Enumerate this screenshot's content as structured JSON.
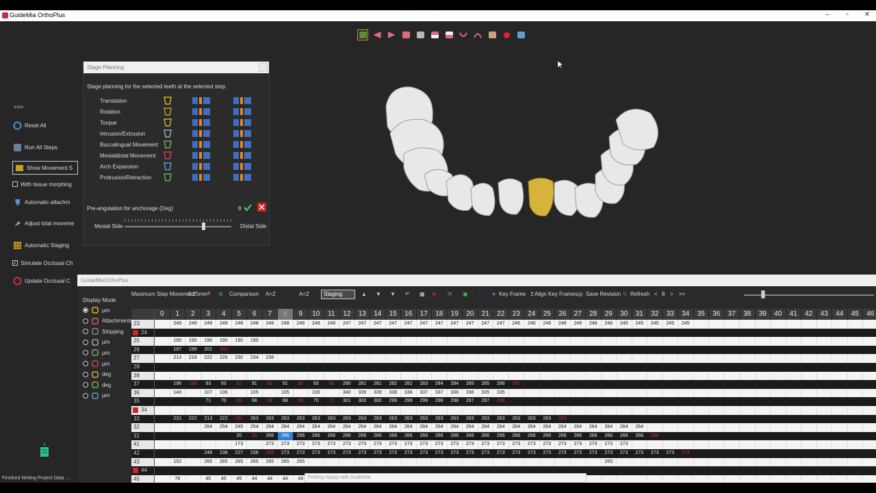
{
  "window": {
    "title": "GuideMia OrthoPlus"
  },
  "left_tools": {
    "expand": ">>>",
    "items": [
      {
        "label": "Reset All"
      },
      {
        "label": "Run All Steps"
      },
      {
        "label": "Show Movement S"
      },
      {
        "label": "With tissue morphing"
      },
      {
        "label": "Automatic attachm"
      },
      {
        "label": "Adjust total moveme"
      },
      {
        "label": "Automatic Staging"
      },
      {
        "label": "Simulate Occlusal Ch"
      },
      {
        "label": "Update Occlusal C"
      }
    ]
  },
  "stage_panel": {
    "title": "Stage Planning",
    "description": "Stage planning for the selected teeth at the selected step.",
    "movements": [
      {
        "label": "Translation",
        "icon": "translation-arrow-icon",
        "color": "#e0b020"
      },
      {
        "label": "Rotation",
        "icon": "rotation-icon",
        "color": "#c0a020"
      },
      {
        "label": "Torque",
        "icon": "torque-tooth-icon",
        "color": "#c8b040"
      },
      {
        "label": "Intrusion/Extrusion",
        "icon": "intrusion-tooth-icon",
        "color": "#a0a8b8"
      },
      {
        "label": "Buccalingual Movement",
        "icon": "buccalingual-tooth-icon",
        "color": "#7ab050"
      },
      {
        "label": "Mesialdistal Movement",
        "icon": "mesialdistal-tooth-icon",
        "color": "#d04060"
      },
      {
        "label": "Arch Expansion",
        "icon": "arch-expansion-icon",
        "color": "#50a0d0"
      },
      {
        "label": "Protrusion/Retraction",
        "icon": "protrusion-icon",
        "color": "#60b060"
      }
    ],
    "pre_angulation_label": "Pre-angulation for anchorage (Deg)",
    "pre_angulation_value": "8",
    "mesial_label": "Mesial Side",
    "distal_label": "Distal Side"
  },
  "bottom_panel": {
    "title": "GuideMiaOrthoPlus",
    "display_mode_label": "Display Mode",
    "display_modes": [
      {
        "label": "µm",
        "selected": true
      },
      {
        "label": "Attachments",
        "selected": false
      },
      {
        "label": "Stripping",
        "selected": false
      },
      {
        "label": "µm",
        "selected": false
      },
      {
        "label": "µm",
        "selected": false
      },
      {
        "label": "µm",
        "selected": false
      },
      {
        "label": "deg",
        "selected": false
      },
      {
        "label": "deg",
        "selected": false
      },
      {
        "label": "µm",
        "selected": false
      }
    ],
    "toolbar": {
      "max_step_label": "Maximum Step Movement",
      "max_step_value": "0.25mm",
      "comparison": "Comparison",
      "a_to_z": "A>Z",
      "z_to_a": "A<Z",
      "staging": "Staging",
      "key_frame": "Key Frame",
      "align_key_frames": "Align Key Frames",
      "save_revision": "Save Revision",
      "refresh": "Refresh",
      "step_prev": "<",
      "step_value": "8",
      "step_next": ">",
      "step_last": ">>"
    },
    "columns": [
      "0",
      "1",
      "2",
      "3",
      "4",
      "5",
      "6",
      "7",
      "8",
      "9",
      "10",
      "11",
      "12",
      "13",
      "14",
      "15",
      "16",
      "17",
      "18",
      "19",
      "20",
      "21",
      "22",
      "23",
      "24",
      "25",
      "26",
      "27",
      "28",
      "29",
      "30",
      "31",
      "32",
      "33",
      "34",
      "35",
      "36",
      "37",
      "38",
      "39",
      "40",
      "41",
      "42",
      "43",
      "44",
      "45",
      "46"
    ],
    "rows": [
      {
        "tooth": "23",
        "cells": [
          "",
          "249",
          "249",
          "249",
          "249",
          "248",
          "248",
          "248",
          "248",
          "248",
          "248",
          "248",
          "247",
          "247",
          "247",
          "247",
          "247",
          "247",
          "247",
          "247",
          "247",
          "247",
          "247",
          "246",
          "246",
          "246",
          "246",
          "246",
          "246",
          "246",
          "245",
          "245",
          "245",
          "245",
          "245",
          "",
          "",
          "",
          "",
          "",
          "",
          "",
          "",
          "",
          "",
          ""
        ],
        "red": []
      },
      {
        "tooth": "24",
        "missing": true,
        "cells": [],
        "red": []
      },
      {
        "tooth": "25",
        "cells": [
          "",
          "190",
          "190",
          "190",
          "190",
          "190",
          "190",
          "",
          "",
          "",
          "",
          "",
          "",
          "",
          "",
          "",
          "",
          "",
          "",
          "",
          "",
          "",
          "",
          ""
        ],
        "red": []
      },
      {
        "tooth": "26",
        "cells": [
          "",
          "197",
          "199",
          "201",
          "202"
        ],
        "red": [
          4
        ]
      },
      {
        "tooth": "27",
        "cells": [
          "",
          "213",
          "218",
          "222",
          "226",
          "230",
          "234",
          "238"
        ],
        "red": []
      },
      {
        "tooth": "28",
        "cells": [],
        "red": []
      },
      {
        "tooth": "38",
        "cells": [],
        "red": []
      },
      {
        "tooth": "37",
        "cells": [
          "",
          "196",
          "196",
          "93",
          "93",
          "92",
          "91",
          "91",
          "91",
          "92",
          "93",
          "93",
          "280",
          "281",
          "281",
          "282",
          "282",
          "283",
          "284",
          "284",
          "285",
          "285",
          "286",
          "287"
        ],
        "red": [
          2,
          5,
          7,
          9,
          11,
          23
        ]
      },
      {
        "tooth": "36",
        "cells": [
          "",
          "140",
          "",
          "107",
          "106",
          "",
          "105",
          "",
          "105",
          "",
          "106",
          "",
          "340",
          "339",
          "339",
          "338",
          "338",
          "337",
          "337",
          "336",
          "336",
          "335",
          "335"
        ],
        "red": []
      },
      {
        "tooth": "35",
        "cells": [
          "",
          "",
          "",
          "71",
          "70",
          "69",
          "68",
          "68",
          "68",
          "69",
          "70",
          "71",
          "301",
          "300",
          "300",
          "299",
          "299",
          "299",
          "298",
          "298",
          "297",
          "297",
          "296"
        ],
        "red": [
          5,
          7,
          9,
          11,
          22
        ]
      },
      {
        "tooth": "34",
        "missing": true,
        "cells": [],
        "red": []
      },
      {
        "tooth": "33",
        "cells": [
          "",
          "231",
          "222",
          "213",
          "222",
          "231",
          "263",
          "263",
          "263",
          "263",
          "263",
          "263",
          "263",
          "263",
          "263",
          "263",
          "263",
          "263",
          "263",
          "263",
          "263",
          "263",
          "263",
          "263",
          "263",
          "263",
          "263"
        ],
        "red": [
          5,
          26
        ]
      },
      {
        "tooth": "32",
        "cells": [
          "",
          "",
          "",
          "264",
          "254",
          "245",
          "254",
          "264",
          "264",
          "264",
          "264",
          "264",
          "264",
          "264",
          "264",
          "264",
          "264",
          "264",
          "264",
          "264",
          "264",
          "264",
          "264",
          "264",
          "264",
          "264",
          "264",
          "264",
          "264",
          "264",
          "264",
          "264"
        ],
        "red": []
      },
      {
        "tooth": "31",
        "cells": [
          "",
          "",
          "",
          "",
          "",
          "20",
          "20",
          "266",
          "266",
          "266",
          "266",
          "266",
          "266",
          "266",
          "266",
          "266",
          "266",
          "266",
          "266",
          "266",
          "266",
          "266",
          "266",
          "266",
          "266",
          "266",
          "266",
          "266",
          "266",
          "266",
          "266",
          "266",
          "266"
        ],
        "red": [
          6,
          32
        ]
      },
      {
        "tooth": "41",
        "cells": [
          "",
          "",
          "",
          "",
          "",
          "173",
          "",
          "273",
          "273",
          "273",
          "273",
          "273",
          "273",
          "273",
          "273",
          "273",
          "273",
          "273",
          "273",
          "273",
          "273",
          "273",
          "273",
          "273",
          "273",
          "273",
          "273",
          "273",
          "273",
          "273",
          "273"
        ],
        "red": []
      },
      {
        "tooth": "42",
        "cells": [
          "",
          "",
          "",
          "248",
          "238",
          "227",
          "238",
          "249",
          "273",
          "273",
          "273",
          "273",
          "273",
          "273",
          "273",
          "273",
          "273",
          "273",
          "273",
          "273",
          "273",
          "273",
          "273",
          "273",
          "273",
          "273",
          "273",
          "273",
          "273",
          "273",
          "273",
          "273",
          "273",
          "273",
          "273"
        ],
        "red": [
          7,
          34
        ]
      },
      {
        "tooth": "43",
        "cells": [
          "",
          "152",
          "",
          "265",
          "265",
          "265",
          "265",
          "265",
          "265",
          "265",
          "",
          "",
          "",
          "",
          "",
          "",
          "",
          "",
          "",
          "",
          "",
          "",
          "",
          "",
          "",
          "",
          "",
          "",
          "",
          "265"
        ],
        "red": []
      },
      {
        "tooth": "44",
        "missing": true,
        "cells": [],
        "red": []
      },
      {
        "tooth": "45",
        "cells": [
          "",
          "79",
          "",
          "45",
          "45",
          "45",
          "44",
          "44",
          "44",
          "43"
        ],
        "red": []
      }
    ],
    "selected_cell": {
      "row": 13,
      "col": 8
    },
    "tooltip": "Feeling Happy with GuideMia"
  },
  "status": "Finished Writing Project Data ..."
}
